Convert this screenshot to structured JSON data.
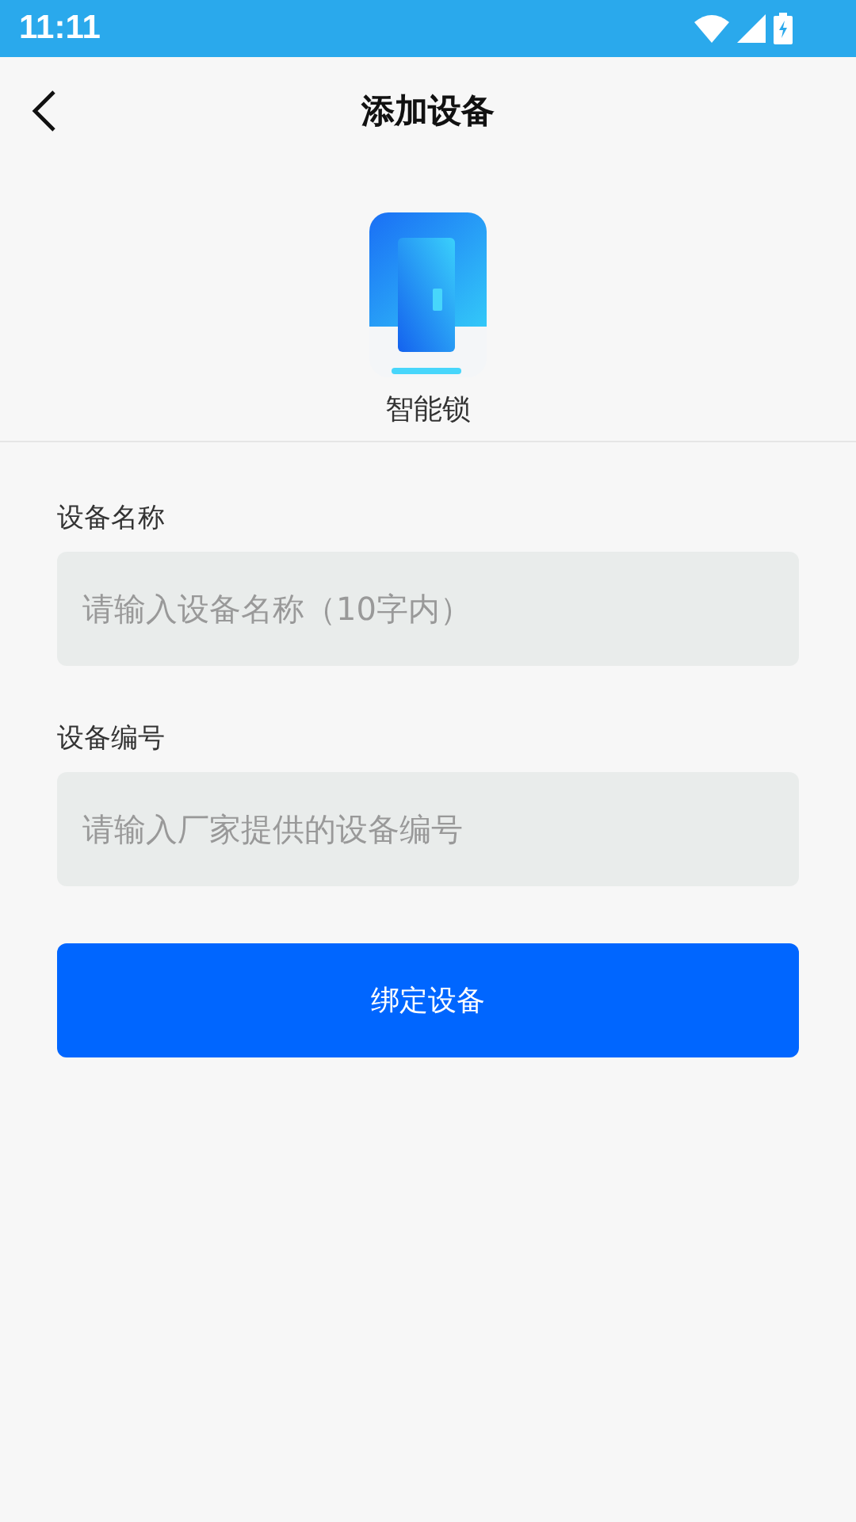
{
  "status_bar": {
    "time": "11:11"
  },
  "header": {
    "title": "添加设备"
  },
  "device": {
    "name": "智能锁"
  },
  "fields": [
    {
      "label": "设备名称",
      "placeholder": "请输入设备名称（10字内）"
    },
    {
      "label": "设备编号",
      "placeholder": "请输入厂家提供的设备编号"
    }
  ],
  "buttons": [
    "绑定设备"
  ]
}
